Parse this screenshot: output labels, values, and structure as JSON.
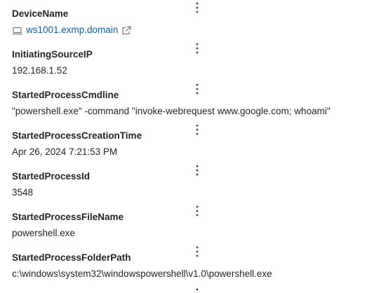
{
  "fields": [
    {
      "label": "DeviceName",
      "value": "ws1001.exmp.domain",
      "is_link": true
    },
    {
      "label": "InitiatingSourceIP",
      "value": "192.168.1.52"
    },
    {
      "label": "StartedProcessCmdline",
      "value": "\"powershell.exe\" -command \"invoke-webrequest www.google.com; whoami\""
    },
    {
      "label": "StartedProcessCreationTime",
      "value": "Apr 26, 2024 7:21:53 PM"
    },
    {
      "label": "StartedProcessId",
      "value": "3548"
    },
    {
      "label": "StartedProcessFileName",
      "value": "powershell.exe"
    },
    {
      "label": "StartedProcessFolderPath",
      "value": "c:\\windows\\system32\\windowspowershell\\v1.0\\powershell.exe"
    }
  ],
  "icons": {
    "more": "more-vertical-icon",
    "device": "laptop-icon",
    "open": "open-external-icon"
  },
  "colors": {
    "link": "#115ea3",
    "text": "#242424",
    "icon": "#424242"
  }
}
